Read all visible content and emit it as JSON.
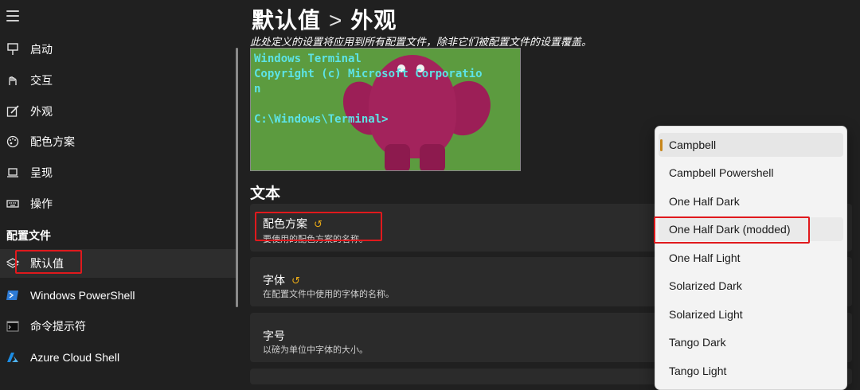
{
  "sidebar": {
    "items": [
      {
        "label": "启动",
        "icon": "launch-icon"
      },
      {
        "label": "交互",
        "icon": "interaction-icon"
      },
      {
        "label": "外观",
        "icon": "appearance-icon"
      },
      {
        "label": "配色方案",
        "icon": "palette-icon"
      },
      {
        "label": "呈现",
        "icon": "rendering-icon"
      },
      {
        "label": "操作",
        "icon": "keyboard-icon"
      }
    ],
    "profiles_header": "配置文件",
    "profiles": [
      {
        "label": "默认值",
        "icon": "layers-icon"
      },
      {
        "label": "Windows PowerShell",
        "icon": "powershell-icon"
      },
      {
        "label": "命令提示符",
        "icon": "cmd-icon"
      },
      {
        "label": "Azure Cloud Shell",
        "icon": "azure-icon"
      }
    ]
  },
  "main": {
    "breadcrumb_parent": "默认值",
    "breadcrumb_sep": ">",
    "breadcrumb_current": "外观",
    "subtitle": "此处定义的设置将应用到所有配置文件，除非它们被配置文件的设置覆盖。",
    "preview_text": "Windows Terminal\nCopyright (c) Microsoft Corporatio\nn\n\nC:\\Windows\\Terminal>",
    "section_text": "文本",
    "settings": [
      {
        "title": "配色方案",
        "reset": "↺",
        "desc": "要使用的配色方案的名称。"
      },
      {
        "title": "字体",
        "reset": "↺",
        "desc": "在配置文件中使用的字体的名称。"
      },
      {
        "title": "字号",
        "reset": "",
        "desc": "以磅为单位中字体的大小。"
      }
    ]
  },
  "dropdown": {
    "options": [
      "Campbell",
      "Campbell Powershell",
      "One Half Dark",
      "One Half Dark (modded)",
      "One Half Light",
      "Solarized Dark",
      "Solarized Light",
      "Tango Dark",
      "Tango Light"
    ],
    "selected": "Campbell",
    "highlighted": "One Half Dark (modded)"
  },
  "colors": {
    "accent": "#c8861a",
    "annotation": "#e0191d",
    "reset_icon": "#e6a817",
    "terminal_text": "#5de3e6"
  }
}
